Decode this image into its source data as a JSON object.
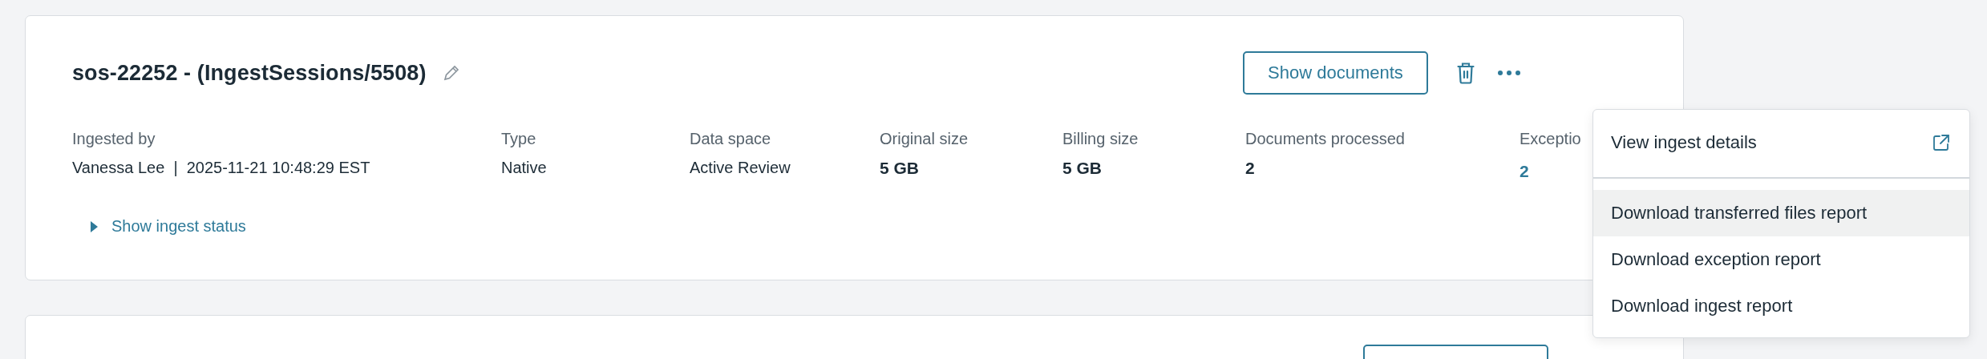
{
  "session": {
    "title": "sos-22252 - (IngestSessions/5508)",
    "show_button": "Show documents",
    "fields": [
      {
        "label": "Ingested by",
        "value": "Vanessa Lee  |  2025-11-21 10:48:29 EST",
        "kind": "plain"
      },
      {
        "label": "Type",
        "value": "Native",
        "kind": "plain"
      },
      {
        "label": "Data space",
        "value": "Active Review",
        "kind": "plain"
      },
      {
        "label": "Original size",
        "value": "5 GB",
        "kind": "strong"
      },
      {
        "label": "Billing size",
        "value": "5 GB",
        "kind": "strong"
      },
      {
        "label": "Documents processed",
        "value": "2",
        "kind": "strong"
      },
      {
        "label": "Exceptio",
        "value": "2",
        "kind": "link"
      }
    ],
    "toggle": {
      "label": "Show ingest status",
      "expanded": false
    }
  },
  "menu": {
    "groups": [
      {
        "items": [
          {
            "label": "View ingest details",
            "kind": "external",
            "highlighted": false
          }
        ]
      },
      {
        "items": [
          {
            "label": "Download transferred files report",
            "kind": "action",
            "highlighted": true
          },
          {
            "label": "Download exception report",
            "kind": "action",
            "highlighted": false
          },
          {
            "label": "Download ingest report",
            "kind": "action",
            "highlighted": false
          }
        ]
      }
    ]
  }
}
